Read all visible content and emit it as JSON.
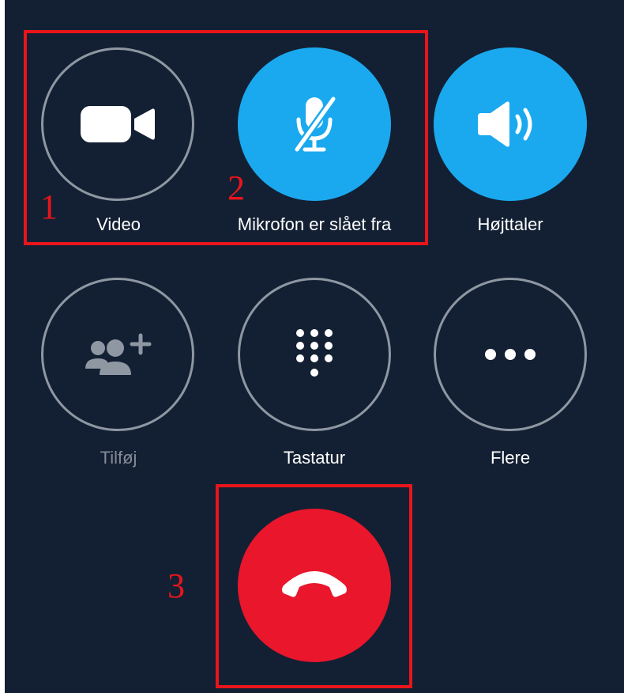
{
  "controls": {
    "video": {
      "label": "Video",
      "icon": "video-camera-icon",
      "state": "off"
    },
    "microphone": {
      "label": "Mikrofon er slået fra",
      "icon": "microphone-muted-icon",
      "state": "muted"
    },
    "speaker": {
      "label": "Højttaler",
      "icon": "speaker-icon",
      "state": "on"
    },
    "add": {
      "label": "Tilføj",
      "icon": "add-participant-icon",
      "state": "disabled"
    },
    "keypad": {
      "label": "Tastatur",
      "icon": "dialpad-icon"
    },
    "more": {
      "label": "Flere",
      "icon": "more-dots-icon"
    },
    "hangup": {
      "icon": "end-call-icon"
    }
  },
  "annotations": [
    {
      "number": "1"
    },
    {
      "number": "2"
    },
    {
      "number": "3"
    }
  ],
  "colors": {
    "background": "#132033",
    "accent_blue": "#1aa9ef",
    "hangup_red": "#e9162c",
    "annotation_red": "#e8151b",
    "outline_gray": "#8e97a2"
  }
}
